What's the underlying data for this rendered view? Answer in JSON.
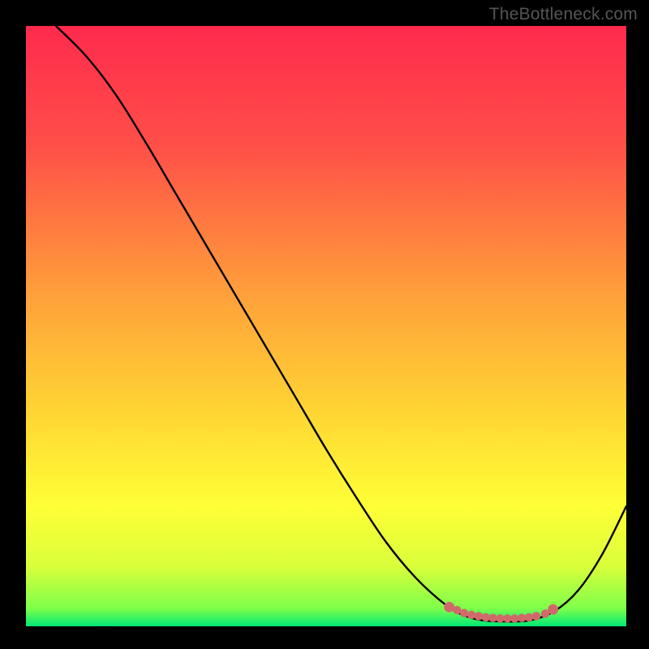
{
  "watermark": "TheBottleneck.com",
  "chart_data": {
    "type": "line",
    "title": "",
    "xlabel": "",
    "ylabel": "",
    "xlim": [
      0,
      100
    ],
    "ylim": [
      0,
      100
    ],
    "background_gradient_stops": [
      {
        "offset": 0.0,
        "color": "#ff2a4d"
      },
      {
        "offset": 0.2,
        "color": "#ff4f48"
      },
      {
        "offset": 0.45,
        "color": "#ffa13a"
      },
      {
        "offset": 0.65,
        "color": "#ffd733"
      },
      {
        "offset": 0.8,
        "color": "#ffff37"
      },
      {
        "offset": 0.9,
        "color": "#d9ff3a"
      },
      {
        "offset": 0.97,
        "color": "#7fff4a"
      },
      {
        "offset": 1.0,
        "color": "#00e876"
      }
    ],
    "series": [
      {
        "name": "bottleneck-curve",
        "color": "#000000",
        "x": [
          5,
          10,
          15,
          20,
          25,
          30,
          35,
          40,
          45,
          50,
          55,
          60,
          65,
          70,
          73,
          76,
          80,
          84,
          88,
          92,
          96,
          100
        ],
        "y": [
          100,
          95,
          88.5,
          80.5,
          72,
          63.5,
          55,
          46.5,
          38,
          29.5,
          21.5,
          14,
          8,
          3.5,
          1.8,
          1.0,
          0.8,
          1.0,
          2.5,
          6,
          12,
          20
        ]
      }
    ],
    "markers": {
      "name": "minimum-band",
      "color": "#d06a6a",
      "points": [
        {
          "x": 70.5,
          "y": 3.2
        },
        {
          "x": 71.8,
          "y": 2.7
        },
        {
          "x": 73.0,
          "y": 2.2
        },
        {
          "x": 74.2,
          "y": 1.9
        },
        {
          "x": 75.4,
          "y": 1.7
        },
        {
          "x": 76.6,
          "y": 1.5
        },
        {
          "x": 77.8,
          "y": 1.4
        },
        {
          "x": 79.0,
          "y": 1.3
        },
        {
          "x": 80.2,
          "y": 1.3
        },
        {
          "x": 81.4,
          "y": 1.3
        },
        {
          "x": 82.6,
          "y": 1.4
        },
        {
          "x": 83.8,
          "y": 1.5
        },
        {
          "x": 85.0,
          "y": 1.7
        },
        {
          "x": 86.5,
          "y": 2.1
        },
        {
          "x": 87.8,
          "y": 2.8
        }
      ]
    }
  }
}
